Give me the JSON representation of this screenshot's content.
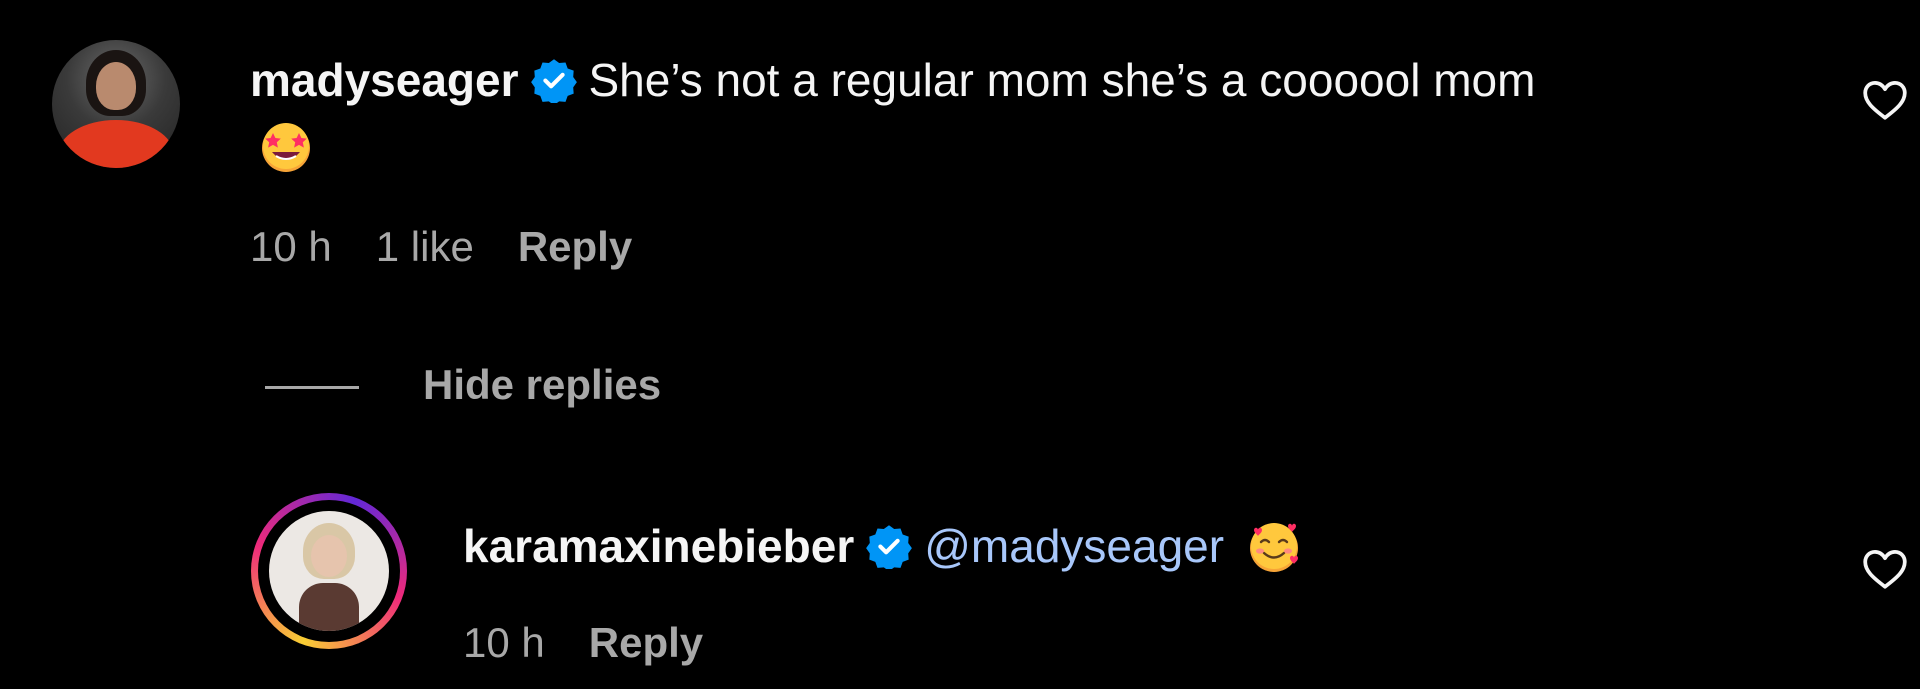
{
  "comment": {
    "username": "madyseager",
    "verified": true,
    "text": "She’s not a regular mom she’s a coooool mom",
    "emoji": "star-struck-emoji",
    "time": "10 h",
    "likes": "1 like",
    "reply_label": "Reply",
    "avatar": "avatar"
  },
  "replies_toggle": {
    "label": "Hide replies"
  },
  "reply": {
    "username": "karamaxinebieber",
    "verified": true,
    "mention": "@madyseager",
    "emoji": "smiling-face-with-hearts-emoji",
    "time": "10 h",
    "reply_label": "Reply",
    "avatar": "avatar-with-story-ring"
  },
  "colors": {
    "background": "#000000",
    "text": "#f5f5f5",
    "muted": "#a8a8a8",
    "mention": "#a8c7fa",
    "verified_badge": "#0095f6"
  },
  "icons": {
    "like": "heart-icon",
    "verified": "verified-badge-icon"
  }
}
